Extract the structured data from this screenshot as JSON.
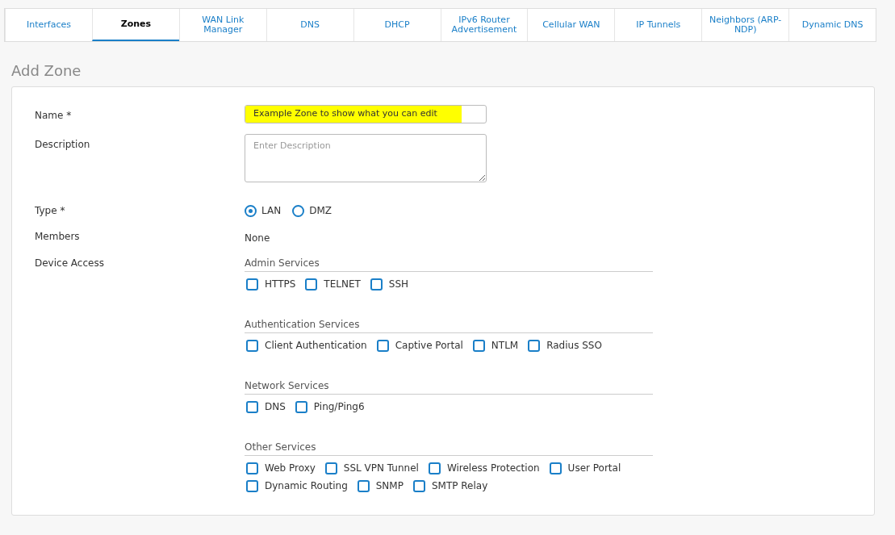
{
  "tabs": [
    {
      "label": "Interfaces",
      "selected": false
    },
    {
      "label": "Zones",
      "selected": true
    },
    {
      "label": "WAN Link Manager",
      "selected": false
    },
    {
      "label": "DNS",
      "selected": false
    },
    {
      "label": "DHCP",
      "selected": false
    },
    {
      "label": "IPv6 Router Advertisement",
      "selected": false
    },
    {
      "label": "Cellular WAN",
      "selected": false
    },
    {
      "label": "IP Tunnels",
      "selected": false
    },
    {
      "label": "Neighbors (ARP-NDP)",
      "selected": false
    },
    {
      "label": "Dynamic DNS",
      "selected": false
    }
  ],
  "page_title": "Add Zone",
  "form": {
    "name": {
      "label": "Name *",
      "value": "Example Zone to show what you can edit",
      "highlighted": true
    },
    "description": {
      "label": "Description",
      "placeholder": "Enter Description"
    },
    "type": {
      "label": "Type *",
      "options": [
        {
          "label": "LAN",
          "selected": true
        },
        {
          "label": "DMZ",
          "selected": false
        }
      ]
    },
    "members": {
      "label": "Members",
      "value": "None"
    },
    "device_access": {
      "label": "Device Access",
      "groups": [
        {
          "title": "Admin Services",
          "items": [
            {
              "label": "HTTPS",
              "checked": false
            },
            {
              "label": "TELNET",
              "checked": false
            },
            {
              "label": "SSH",
              "checked": false
            }
          ]
        },
        {
          "title": "Authentication Services",
          "items": [
            {
              "label": "Client Authentication",
              "checked": false
            },
            {
              "label": "Captive Portal",
              "checked": false
            },
            {
              "label": "NTLM",
              "checked": false
            },
            {
              "label": "Radius SSO",
              "checked": false
            }
          ]
        },
        {
          "title": "Network Services",
          "items": [
            {
              "label": "DNS",
              "checked": false
            },
            {
              "label": "Ping/Ping6",
              "checked": false
            }
          ]
        },
        {
          "title": "Other Services",
          "items": [
            {
              "label": "Web Proxy",
              "checked": false
            },
            {
              "label": "SSL VPN Tunnel",
              "checked": false
            },
            {
              "label": "Wireless Protection",
              "checked": false
            },
            {
              "label": "User Portal",
              "checked": false
            },
            {
              "label": "Dynamic Routing",
              "checked": false
            },
            {
              "label": "SNMP",
              "checked": false
            },
            {
              "label": "SMTP Relay",
              "checked": false
            }
          ]
        }
      ]
    }
  }
}
